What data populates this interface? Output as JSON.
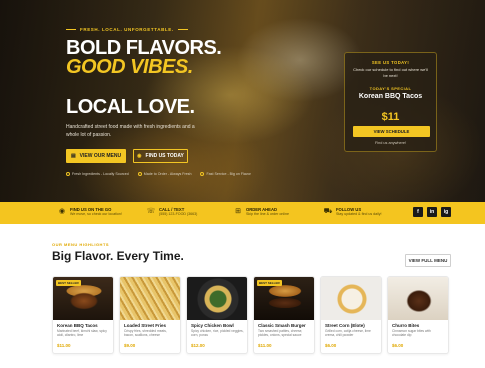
{
  "hero": {
    "eyebrow": "FRESH. LOCAL. UNFORGETTABLE.",
    "headline_1": "BOLD FLAVORS.",
    "headline_2": "GOOD VIBES.",
    "headline_3": "LOCAL LOVE.",
    "description": "Handcrafted street food made with fresh ingredients and a whole lot of passion.",
    "primary_button": "VIEW OUR MENU",
    "secondary_button": "FIND US TODAY",
    "features": [
      "Fresh Ingredients - Locally Sourced",
      "Made to Order - Always Fresh",
      "Fast Service - Big on Flavor"
    ]
  },
  "visit_card": {
    "title": "SEE US TODAY!",
    "subtitle": "Check our schedule to find out where we'll be next!",
    "special_label": "TODAY'S SPECIAL",
    "special_name": "Korean BBQ Tacos",
    "special_price": "$11",
    "button": "VIEW SCHEDULE",
    "note": "Find us anywhere!"
  },
  "info_bar": {
    "items": [
      {
        "title": "FIND US ON THE GO",
        "sub": "We move, so check our location!",
        "icon": "location-pin-icon"
      },
      {
        "title": "CALL / TEXT",
        "sub": "(555) 123-FOOD (3663)",
        "icon": "phone-icon"
      },
      {
        "title": "ORDER AHEAD",
        "sub": "Skip the line & order online",
        "icon": "cart-icon"
      },
      {
        "title": "FOLLOW US",
        "sub": "Stay updated & find us daily!",
        "icon": "truck-icon"
      }
    ],
    "social": [
      "f",
      "in",
      "ig"
    ]
  },
  "menu": {
    "eyebrow": "OUR MENU HIGHLIGHTS",
    "title": "Big Flavor. Every Time.",
    "view_full": "VIEW FULL MENU",
    "items": [
      {
        "name": "Korean BBQ Tacos",
        "desc": "Marinated beef, kimchi slaw, spicy aioli, cilantro, lime",
        "price": "$11.00",
        "tag": "BEST SELLER"
      },
      {
        "name": "Loaded Street Fries",
        "desc": "Crispy fries, shredded meats, bacon, scallions, cheese",
        "price": "$9.00",
        "tag": ""
      },
      {
        "name": "Spicy Chicken Bowl",
        "desc": "Spicy chicken, rice, pickled veggies, corn, ponzu",
        "price": "$12.00",
        "tag": ""
      },
      {
        "name": "Classic Smash Burger",
        "desc": "Two smashed patties, cheese, pickles, onions, special sauce",
        "price": "$11.00",
        "tag": "BEST SELLER"
      },
      {
        "name": "Street Corn (Elote)",
        "desc": "Grilled corn, cotija cheese, lime crema, chili powder",
        "price": "$6.00",
        "tag": ""
      },
      {
        "name": "Churro Bites",
        "desc": "Cinnamon sugar bites with chocolate dip",
        "price": "$6.00",
        "tag": ""
      }
    ]
  },
  "colors": {
    "accent": "#f3c623",
    "dark": "#1c1c1c"
  }
}
